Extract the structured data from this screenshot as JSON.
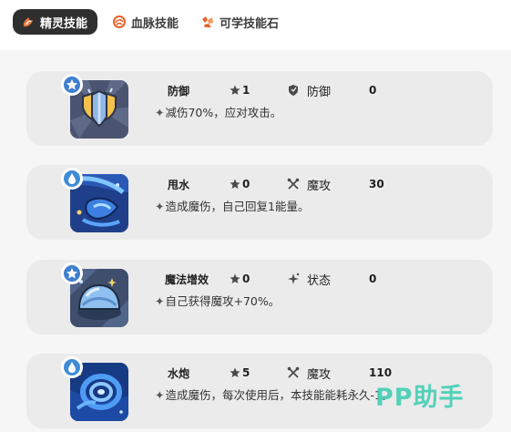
{
  "tabs": [
    {
      "label": "精灵技能",
      "icon": "pet-skill-icon",
      "active": true
    },
    {
      "label": "血脉技能",
      "icon": "bloodline-skill-icon",
      "active": false
    },
    {
      "label": "可学技能石",
      "icon": "skill-stone-icon",
      "active": false
    }
  ],
  "skills": [
    {
      "name": "防御",
      "icon": "shield-skill-icon",
      "attribute": "normal-attribute-icon",
      "power": "1",
      "category_icon": "defense-category-icon",
      "category": "防御",
      "value": "0",
      "description": "减伤70%，应对攻击。"
    },
    {
      "name": "甩水",
      "icon": "water-splash-skill-icon",
      "attribute": "water-attribute-icon",
      "power": "0",
      "category_icon": "magic-attack-category-icon",
      "category": "魔攻",
      "value": "30",
      "description": "造成魔伤，自己回复1能量。"
    },
    {
      "name": "魔法增效",
      "icon": "magic-boost-skill-icon",
      "attribute": "normal-attribute-icon",
      "power": "0",
      "category_icon": "status-category-icon",
      "category": "状态",
      "value": "0",
      "description": "自己获得魔攻+70%。"
    },
    {
      "name": "水炮",
      "icon": "water-cannon-skill-icon",
      "attribute": "water-attribute-icon",
      "power": "5",
      "category_icon": "magic-attack-category-icon",
      "category": "魔攻",
      "value": "110",
      "description": "造成魔伤，每次使用后，本技能能耗永久-1。"
    }
  ],
  "desc_prefix": "✦",
  "watermark": "PP助手",
  "colors": {
    "active_tab": "#2f2f2f",
    "card_bg": "#ebebeb",
    "tab_icon": "#e8622c",
    "watermark": "#47cfb4"
  }
}
